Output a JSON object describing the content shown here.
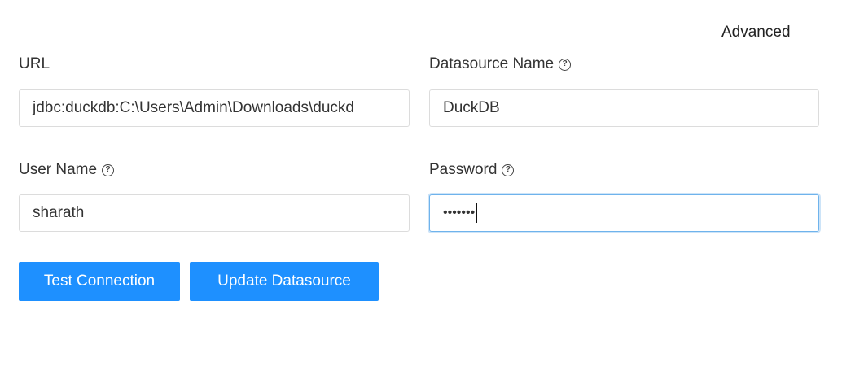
{
  "header": {
    "advanced_label": "Advanced"
  },
  "form": {
    "url": {
      "label": "URL",
      "value": "jdbc:duckdb:C:\\Users\\Admin\\Downloads\\duckd"
    },
    "datasource_name": {
      "label": "Datasource Name",
      "value": "DuckDB"
    },
    "user_name": {
      "label": "User Name",
      "value": "sharath"
    },
    "password": {
      "label": "Password",
      "masked_value": "•••••••"
    }
  },
  "buttons": {
    "test_connection": "Test Connection",
    "update_datasource": "Update Datasource"
  },
  "icons": {
    "help": "help-circle-icon",
    "help_glyph": "?"
  },
  "colors": {
    "primary": "#1e90ff",
    "focus": "#6fb3ec",
    "border": "#dcdcdc"
  }
}
